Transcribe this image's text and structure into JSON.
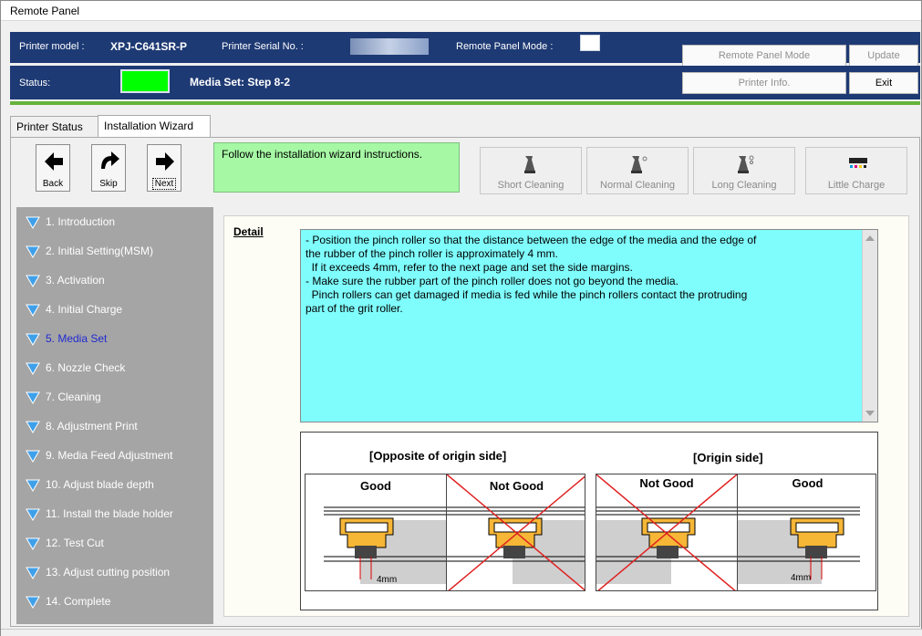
{
  "window": {
    "title": "Remote Panel"
  },
  "header": {
    "printer_model_label": "Printer model :",
    "printer_model": "XPJ-C641SR-P",
    "serial_label": "Printer Serial No. :",
    "remote_mode_label": "Remote Panel Mode :",
    "status_label": "Status:",
    "status_text": "Media Set: Step 8-2",
    "status_color": "#00ff00",
    "buttons": {
      "remote_panel_mode": "Remote Panel Mode",
      "update": "Update",
      "printer_info": "Printer Info.",
      "exit": "Exit"
    }
  },
  "tabs": [
    {
      "label": "Printer Status"
    },
    {
      "label": "Installation Wizard"
    }
  ],
  "toolbar": {
    "back": "Back",
    "skip": "Skip",
    "next": "Next",
    "message": "Follow the installation wizard instructions.",
    "short_cleaning": "Short Cleaning",
    "normal_cleaning": "Normal Cleaning",
    "long_cleaning": "Long Cleaning",
    "little_charge": "Little Charge"
  },
  "steps": [
    {
      "label": "1. Introduction"
    },
    {
      "label": "2. Initial Setting(MSM)"
    },
    {
      "label": "3. Activation"
    },
    {
      "label": "4. Initial Charge"
    },
    {
      "label": "5. Media Set",
      "active": true
    },
    {
      "label": "6. Nozzle Check"
    },
    {
      "label": "7. Cleaning"
    },
    {
      "label": "8. Adjustment Print"
    },
    {
      "label": "9. Media Feed Adjustment"
    },
    {
      "label": "10. Adjust blade depth"
    },
    {
      "label": "11. Install the blade holder"
    },
    {
      "label": "12. Test Cut"
    },
    {
      "label": "13. Adjust cutting position"
    },
    {
      "label": "14. Complete"
    }
  ],
  "detail": {
    "label": "Detail",
    "lines": [
      "- Position the pinch roller so that the distance between the edge of the media and the edge of",
      "the rubber of the pinch roller is approximately 4 mm.",
      "  If it exceeds 4mm, refer to the next page and set the side margins.",
      "- Make sure the rubber part of the pinch roller does not go beyond the media.",
      "  Pinch rollers can get damaged if media is fed while the pinch rollers contact the protruding",
      "part of the grit roller."
    ]
  },
  "figure": {
    "left_title": "[Opposite of origin side]",
    "right_title": "[Origin side]",
    "good": "Good",
    "not_good": "Not Good",
    "measure": "4mm"
  },
  "colors": {
    "header_bg": "#1e3a74",
    "accent_green": "#67b33d",
    "message_bg": "#a6f8a4",
    "detail_bg": "#7ffcfc",
    "sidebar_bg": "#a5a5a5",
    "active_step": "#1f2bd1"
  }
}
